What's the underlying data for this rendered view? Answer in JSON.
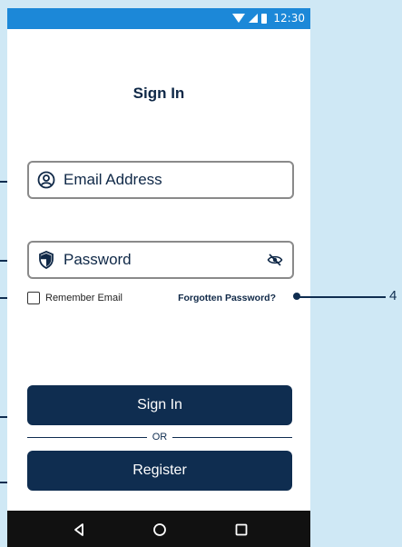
{
  "status_bar": {
    "time": "12:30",
    "wifi_icon": "wifi-icon",
    "signal_icon": "signal-icon",
    "battery_icon": "battery-icon"
  },
  "screen": {
    "title": "Sign In"
  },
  "email_field": {
    "icon": "user-circle-icon",
    "placeholder": "Email Address"
  },
  "password_field": {
    "icon": "shield-icon",
    "placeholder": "Password",
    "toggle_icon": "eye-off-icon"
  },
  "remember": {
    "label": "Remember Email",
    "checked": false
  },
  "forgot_link": "Forgotten Password?",
  "buttons": {
    "sign_in": "Sign In",
    "or": "OR",
    "register": "Register"
  },
  "nav_bar": {
    "back_icon": "back-triangle-icon",
    "home_icon": "home-circle-icon",
    "recent_icon": "recent-square-icon"
  },
  "callouts": {
    "forgot_number": "4"
  },
  "colors": {
    "background": "#cfe8f5",
    "status_bar": "#1c88d8",
    "primary": "#0f2d50",
    "nav_bar": "#111111"
  }
}
